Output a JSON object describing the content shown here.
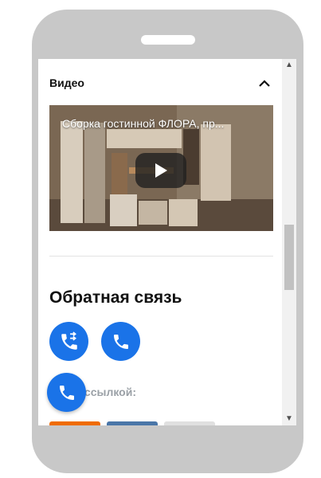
{
  "video_section": {
    "title": "Видео",
    "video_title": "Сборка гостинной ФЛОРА, пр..."
  },
  "feedback": {
    "title": "Обратная связь"
  },
  "share": {
    "label": "иться ссылкой:",
    "colors": [
      "#ef6c00",
      "#4a76a8",
      "#e0e0e0"
    ]
  },
  "colors": {
    "accent": "#1a73e8",
    "phone_frame": "#c8c8c8"
  },
  "icons": [
    "chevron-up-icon",
    "play-icon",
    "call-transfer-icon",
    "phone-icon",
    "arrow-up-icon",
    "arrow-down-icon"
  ]
}
